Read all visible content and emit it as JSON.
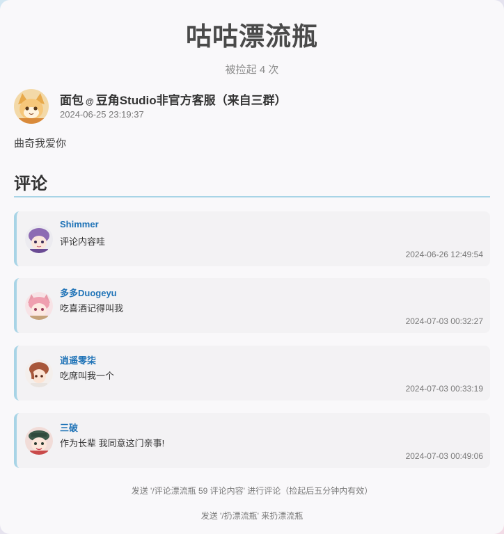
{
  "title": "咕咕漂流瓶",
  "picked_count": "被捡起 4 次",
  "author": {
    "name": "面包",
    "at": "@",
    "group": "豆角Studio非官方客服（来自三群）",
    "time": "2024-06-25 23:19:37"
  },
  "message": "曲奇我爱你",
  "comments_title": "评论",
  "comments": [
    {
      "name": "Shimmer",
      "text": "评论内容哇",
      "time": "2024-06-26 12:49:54"
    },
    {
      "name": "多多Duogeyu",
      "text": "吃喜酒记得叫我",
      "time": "2024-07-03 00:32:27"
    },
    {
      "name": "逍遥零柒",
      "text": "吃席叫我一个",
      "time": "2024-07-03 00:33:19"
    },
    {
      "name": "三破",
      "text": "作为长辈 我同意这门亲事!",
      "time": "2024-07-03 00:49:06"
    }
  ],
  "hints": {
    "comment": "发送 '/评论漂流瓶 59 评论内容' 进行评论（捡起后五分钟内有效）",
    "throw": "发送 '/扔漂流瓶' 来扔漂流瓶"
  },
  "colors": {
    "accent": "#a8d4e6",
    "username": "#1f73b7",
    "card_bg": "#f9f8fa",
    "comment_bg": "#f3f2f4"
  }
}
